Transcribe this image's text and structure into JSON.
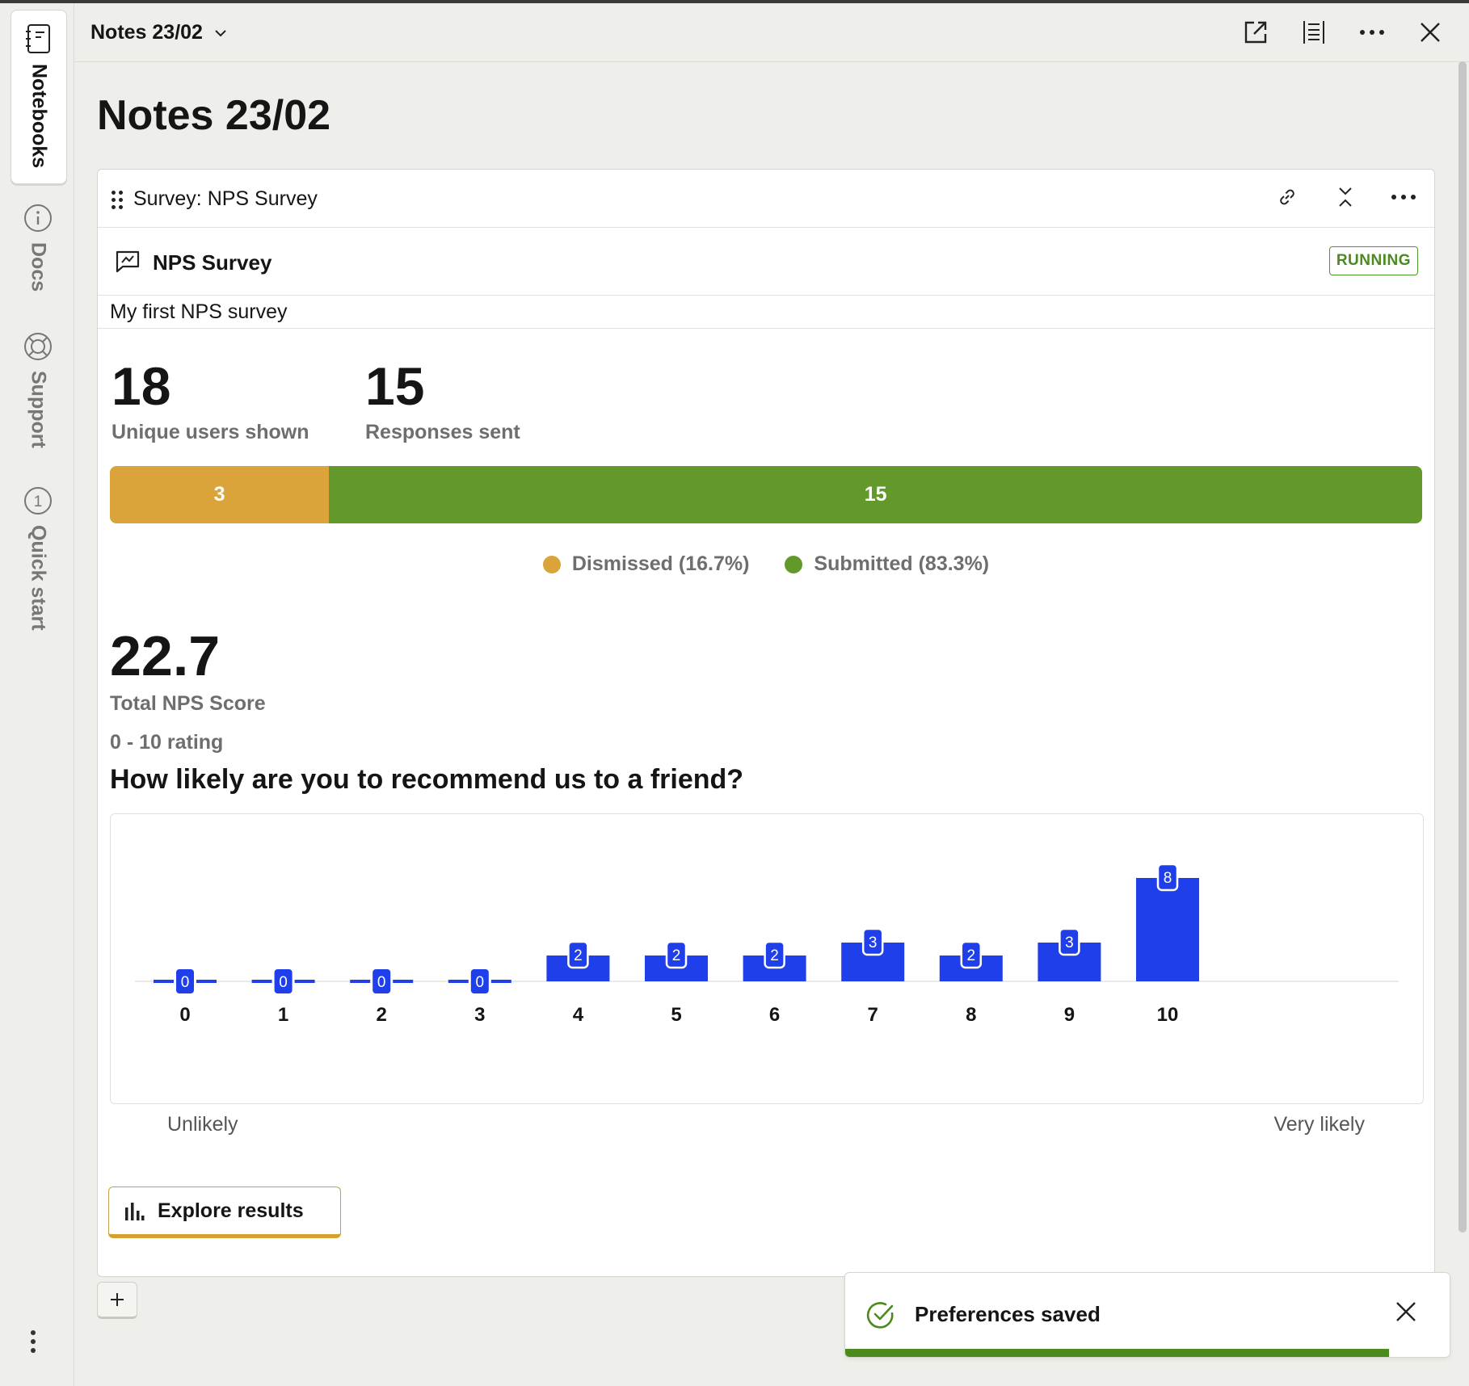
{
  "rail": {
    "items": [
      {
        "label": "Notebooks",
        "icon": "notebook-icon",
        "active": true
      },
      {
        "label": "Docs",
        "icon": "info-icon",
        "active": false
      },
      {
        "label": "Support",
        "icon": "lifebuoy-icon",
        "active": false
      },
      {
        "label": "Quick start",
        "icon": "quick-start-icon",
        "badge": "1",
        "active": false
      }
    ]
  },
  "header": {
    "title": "Notes 23/02",
    "icons": [
      "external-link-icon",
      "table-of-contents-icon",
      "more-icon",
      "close-icon"
    ]
  },
  "page": {
    "title": "Notes 23/02"
  },
  "card": {
    "title": "Survey: NPS Survey",
    "icons": [
      "link-icon",
      "collapse-icon",
      "more-icon"
    ],
    "survey_name": "NPS Survey",
    "status": "RUNNING",
    "description": "My first NPS survey",
    "stats": {
      "users_value": "18",
      "users_label": "Unique users shown",
      "responses_value": "15",
      "responses_label": "Responses sent"
    },
    "breakdown": {
      "dismissed_count": "3",
      "submitted_count": "15",
      "dismissed_fraction": 0.167,
      "dismissed_legend": "Dismissed (16.7%)",
      "submitted_legend": "Submitted (83.3%)",
      "dismissed_color": "#dba43a",
      "submitted_color": "#63992a"
    },
    "nps": {
      "value": "22.7",
      "label": "Total NPS Score"
    },
    "rating_label": "0 - 10 rating",
    "question": "How likely are you to recommend us to a friend?",
    "scale_low": "Unlikely",
    "scale_high": "Very likely",
    "explore_label": "Explore results"
  },
  "chart_data": {
    "type": "bar",
    "categories": [
      "0",
      "1",
      "2",
      "3",
      "4",
      "5",
      "6",
      "7",
      "8",
      "9",
      "10"
    ],
    "values": [
      0,
      0,
      0,
      0,
      2,
      2,
      2,
      3,
      2,
      3,
      8
    ],
    "title": "How likely are you to recommend us to a friend?",
    "xlabel": "",
    "ylabel": "",
    "color": "#1f3fea",
    "grid": false
  },
  "toast": {
    "message": "Preferences saved",
    "progress": 0.9
  }
}
